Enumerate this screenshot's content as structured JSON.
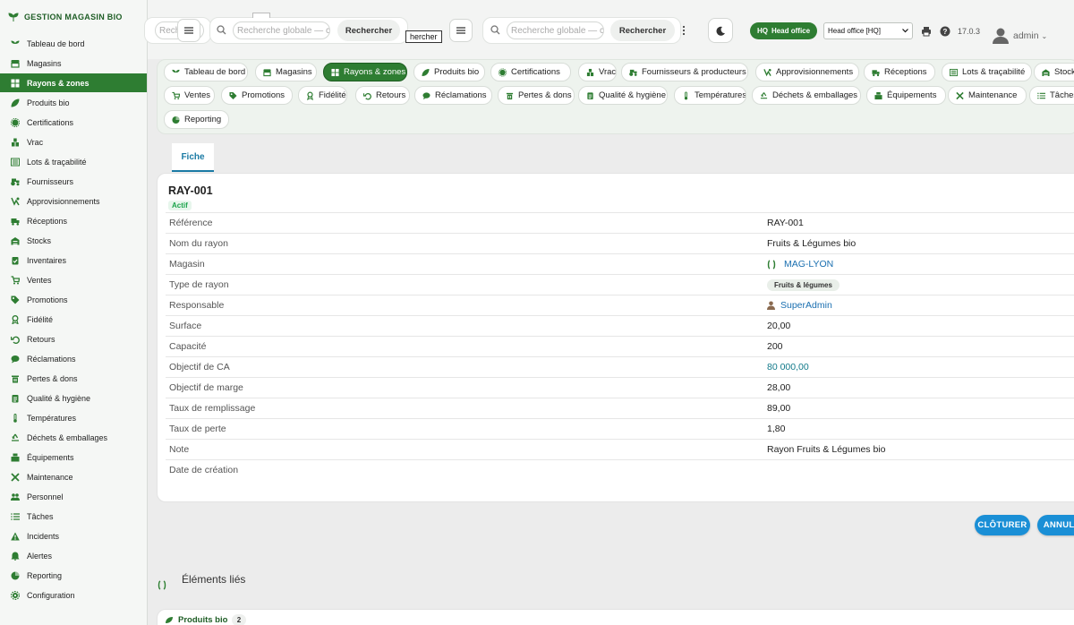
{
  "app": {
    "brand": "GESTION MAGASIN BIO"
  },
  "colors": {
    "primary": "#2e7d32",
    "accent": "#1a8fd6",
    "link": "#1a6fb0",
    "status_active": "#1aa34a"
  },
  "sidebar": {
    "items": [
      {
        "label": "Tableau de bord",
        "icon": "sprout-icon"
      },
      {
        "label": "Magasins",
        "icon": "store-icon"
      },
      {
        "label": "Rayons & zones",
        "icon": "grid-icon",
        "active": true
      },
      {
        "label": "Produits bio",
        "icon": "leaf-icon"
      },
      {
        "label": "Certifications",
        "icon": "certificate-icon"
      },
      {
        "label": "Vrac",
        "icon": "bulk-icon"
      },
      {
        "label": "Lots & traçabilité",
        "icon": "lots-icon"
      },
      {
        "label": "Fournisseurs",
        "icon": "tractor-icon"
      },
      {
        "label": "Approvisionnements",
        "icon": "supply-icon"
      },
      {
        "label": "Réceptions",
        "icon": "truck-icon"
      },
      {
        "label": "Stocks",
        "icon": "warehouse-icon"
      },
      {
        "label": "Inventaires",
        "icon": "clipboard-check-icon"
      },
      {
        "label": "Ventes",
        "icon": "cart-icon"
      },
      {
        "label": "Promotions",
        "icon": "tag-icon"
      },
      {
        "label": "Fidélité",
        "icon": "award-icon"
      },
      {
        "label": "Retours",
        "icon": "undo-icon"
      },
      {
        "label": "Réclamations",
        "icon": "comment-icon"
      },
      {
        "label": "Pertes & dons",
        "icon": "trash-icon"
      },
      {
        "label": "Qualité & hygiène",
        "icon": "clipboard-icon"
      },
      {
        "label": "Températures",
        "icon": "thermometer-icon"
      },
      {
        "label": "Déchets & emballages",
        "icon": "recycle-icon"
      },
      {
        "label": "Équipements",
        "icon": "equipment-icon"
      },
      {
        "label": "Maintenance",
        "icon": "tools-icon"
      },
      {
        "label": "Personnel",
        "icon": "users-icon"
      },
      {
        "label": "Tâches",
        "icon": "list-icon"
      },
      {
        "label": "Incidents",
        "icon": "warning-icon"
      },
      {
        "label": "Alertes",
        "icon": "bell-icon"
      },
      {
        "label": "Reporting",
        "icon": "chart-pie-icon"
      },
      {
        "label": "Configuration",
        "icon": "gear-icon"
      }
    ]
  },
  "topbar": {
    "search1": {
      "placeholder": "Rech",
      "placeholder_tail": "g"
    },
    "search2": {
      "placeholder": "Recherche globale — cl"
    },
    "search3": {
      "placeholder": "Recherche globale — cl"
    },
    "search_button": "Rechercher",
    "overlay_text": "hercher",
    "hq_badge": "HQ",
    "hq_label": "Head office",
    "company_select": "Head office [HQ]",
    "version": "17.0.3",
    "user": "admin"
  },
  "tabs": [
    {
      "label": "Tableau de bord",
      "icon": "sprout-icon"
    },
    {
      "label": "Magasins",
      "icon": "store-icon"
    },
    {
      "label": "Rayons & zones",
      "icon": "grid-icon",
      "active": true
    },
    {
      "label": "Produits bio",
      "icon": "leaf-icon"
    },
    {
      "label": "Certifications",
      "icon": "certificate-icon"
    },
    {
      "label": "Vrac",
      "icon": "bulk-icon"
    },
    {
      "label": "Fournisseurs & producteurs",
      "icon": "tractor-icon"
    },
    {
      "label": "Approvisionnements",
      "icon": "supply-icon"
    },
    {
      "label": "Réceptions",
      "icon": "truck-icon"
    },
    {
      "label": "Lots & traçabilité",
      "icon": "lots-icon"
    },
    {
      "label": "Stock",
      "icon": "warehouse-icon"
    },
    {
      "label": "Ventes",
      "icon": "cart-icon"
    },
    {
      "label": "Promotions",
      "icon": "tag-icon"
    },
    {
      "label": "Fidélité",
      "icon": "award-icon"
    },
    {
      "label": "Retours",
      "icon": "undo-icon"
    },
    {
      "label": "Réclamations",
      "icon": "comment-icon"
    },
    {
      "label": "Pertes & dons",
      "icon": "trash-icon"
    },
    {
      "label": "Qualité & hygiène",
      "icon": "clipboard-icon"
    },
    {
      "label": "Températures",
      "icon": "thermometer-icon"
    },
    {
      "label": "Déchets & emballages",
      "icon": "recycle-icon"
    },
    {
      "label": "Équipements",
      "icon": "equipment-icon"
    },
    {
      "label": "Maintenance",
      "icon": "tools-icon"
    },
    {
      "label": "Tâches",
      "icon": "list-icon"
    },
    {
      "label": "Reporting",
      "icon": "chart-pie-icon"
    }
  ],
  "record": {
    "tab": "Fiche",
    "title": "RAY-001",
    "status": "Actif",
    "fields": [
      {
        "label": "Référence",
        "value": "RAY-001"
      },
      {
        "label": "Nom du rayon",
        "value": "Fruits & Légumes bio"
      },
      {
        "label": "Magasin",
        "value": "MAG-LYON",
        "kind": "link-store"
      },
      {
        "label": "Type de rayon",
        "value": "Fruits & légumes",
        "kind": "chip"
      },
      {
        "label": "Responsable",
        "value": "SuperAdmin",
        "kind": "link-user"
      },
      {
        "label": "Surface",
        "value": "20,00"
      },
      {
        "label": "Capacité",
        "value": "200"
      },
      {
        "label": "Objectif de CA",
        "value": "80 000,00",
        "kind": "money"
      },
      {
        "label": "Objectif de marge",
        "value": "28,00"
      },
      {
        "label": "Taux de remplissage",
        "value": "89,00"
      },
      {
        "label": "Taux de perte",
        "value": "1,80"
      },
      {
        "label": "Note",
        "value": "Rayon Fruits & Légumes bio"
      },
      {
        "label": "Date de création",
        "value": ""
      }
    ]
  },
  "actions": {
    "close": "CLÔTURER",
    "cancel": "ANNULER"
  },
  "linked": {
    "title": "Éléments liés",
    "section": "Produits bio",
    "count": "2"
  }
}
